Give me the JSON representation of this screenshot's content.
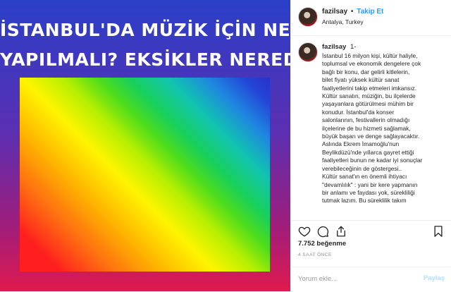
{
  "post_image": {
    "headline_lines": [
      "İSTANBUL'DA MÜZİK İÇİN NELER",
      "YAPILMALI? EKSİKLER NEREDE?"
    ]
  },
  "header": {
    "username": "fazilsay",
    "separator": "•",
    "follow_label": "Takip Et",
    "location": "Antalya, Turkey"
  },
  "caption": {
    "username": "fazilsay",
    "index": "1-",
    "lines": [
      "İstanbul 16 milyon kişi, kültür haliyle,",
      "toplumsal ve ekonomik dengelere çok",
      "bağlı bir konu, dar gelirli kitlelerin,",
      "bilet fiyatı yüksek kültür sanat",
      "faaliyetlerini takip etmeleri imkansız.",
      "Kültür sanatın, müziğin, bu ilçelerde",
      "yaşayanlara götürülmesi mühim bir",
      "konudur. İstanbul'da konser",
      "salonlarının, festivallerin olmadığı",
      "ilçelerine de bu hizmeti sağlamak,",
      "büyük başarı ve denge sağlayacaktır.",
      "Aslında Ekrem İmamoğlu'nun",
      "Beylikdüzü'nde yıllarca gayret ettiği",
      "faaliyetleri bunun ne kadar iyi sonuçlar",
      "verebileceğinin de göstergesi..",
      "Kültür sanat'ın en önemli ihtiyacı",
      "\"devamlılık\" : yani bir kere yapmanın",
      "bir anlamı ve faydası yok, sürekliliği",
      "tutmak lazım. Bu süreklilik takım"
    ]
  },
  "actions": {
    "icons": [
      "heart-icon",
      "comment-icon",
      "share-icon",
      "bookmark-icon"
    ]
  },
  "likes": "7.752 beğenme",
  "timestamp": "4 SAAT ÖNCE",
  "comment": {
    "placeholder": "Yorum ekle...",
    "post_label": "Paylaş"
  },
  "colors": {
    "accent": "#3897f0",
    "post_disabled": "#b2dffc",
    "text": "#262626",
    "muted": "#8e8e8e"
  }
}
